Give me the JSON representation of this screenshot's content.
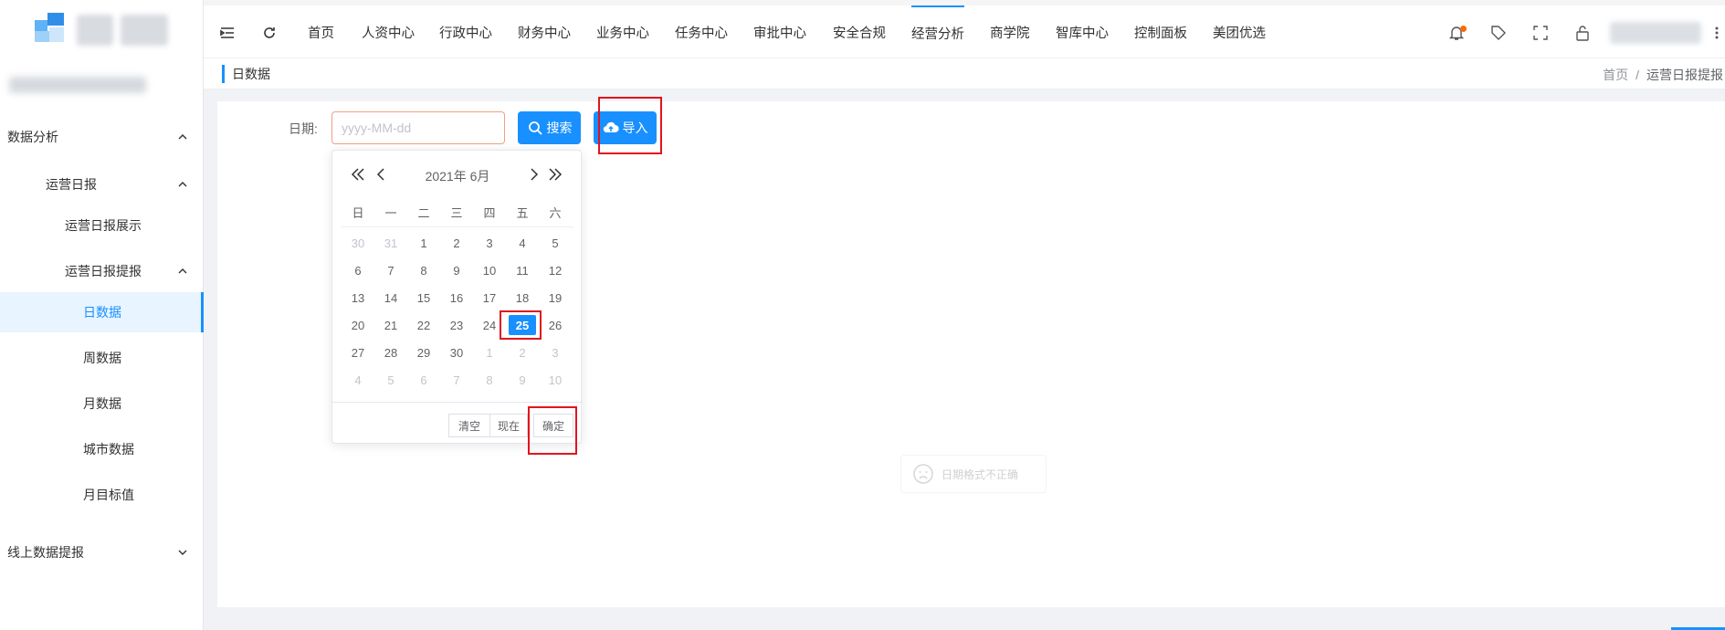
{
  "sidebar": {
    "menu": [
      {
        "label": "数据分析",
        "arrow": "up"
      },
      {
        "label": "运营日报",
        "arrow": "up"
      },
      {
        "label": "运营日报展示",
        "arrow": ""
      },
      {
        "label": "运营日报提报",
        "arrow": "up"
      },
      {
        "label": "日数据",
        "arrow": "",
        "active": true
      },
      {
        "label": "周数据",
        "arrow": ""
      },
      {
        "label": "月数据",
        "arrow": ""
      },
      {
        "label": "城市数据",
        "arrow": ""
      },
      {
        "label": "月目标值",
        "arrow": ""
      },
      {
        "label": "线上数据提报",
        "arrow": "down"
      }
    ]
  },
  "topnav": {
    "items": [
      "首页",
      "人资中心",
      "行政中心",
      "财务中心",
      "业务中心",
      "任务中心",
      "审批中心",
      "安全合规",
      "经营分析",
      "商学院",
      "智库中心",
      "控制面板",
      "美团优选"
    ],
    "active_index": 8
  },
  "breadcrumb": {
    "page_title": "日数据",
    "crumbs": [
      "首页",
      "运营日报提报"
    ]
  },
  "form": {
    "date_label": "日期:",
    "date_placeholder": "yyyy-MM-dd",
    "search_label": "搜索",
    "import_label": "导入"
  },
  "datepicker": {
    "title": "2021年  6月",
    "weekdays": [
      "日",
      "一",
      "二",
      "三",
      "四",
      "五",
      "六"
    ],
    "weeks": [
      [
        {
          "d": "30",
          "o": 1
        },
        {
          "d": "31",
          "o": 1
        },
        {
          "d": "1"
        },
        {
          "d": "2"
        },
        {
          "d": "3"
        },
        {
          "d": "4"
        },
        {
          "d": "5"
        }
      ],
      [
        {
          "d": "6"
        },
        {
          "d": "7"
        },
        {
          "d": "8"
        },
        {
          "d": "9"
        },
        {
          "d": "10"
        },
        {
          "d": "11"
        },
        {
          "d": "12"
        }
      ],
      [
        {
          "d": "13"
        },
        {
          "d": "14"
        },
        {
          "d": "15"
        },
        {
          "d": "16"
        },
        {
          "d": "17"
        },
        {
          "d": "18"
        },
        {
          "d": "19"
        }
      ],
      [
        {
          "d": "20"
        },
        {
          "d": "21"
        },
        {
          "d": "22"
        },
        {
          "d": "23"
        },
        {
          "d": "24"
        },
        {
          "d": "25",
          "sel": 1
        },
        {
          "d": "26"
        }
      ],
      [
        {
          "d": "27"
        },
        {
          "d": "28"
        },
        {
          "d": "29"
        },
        {
          "d": "30"
        },
        {
          "d": "1",
          "o": 1
        },
        {
          "d": "2",
          "o": 1
        },
        {
          "d": "3",
          "o": 1
        }
      ],
      [
        {
          "d": "4",
          "o": 1
        },
        {
          "d": "5",
          "o": 1
        },
        {
          "d": "6",
          "o": 1
        },
        {
          "d": "7",
          "o": 1
        },
        {
          "d": "8",
          "o": 1
        },
        {
          "d": "9",
          "o": 1
        },
        {
          "d": "10",
          "o": 1
        }
      ]
    ],
    "clear_label": "清空",
    "now_label": "现在",
    "confirm_label": "确定"
  },
  "empty_tip": "日期格式不正确",
  "colors": {
    "primary": "#1890ff",
    "highlight": "#e2141c"
  }
}
